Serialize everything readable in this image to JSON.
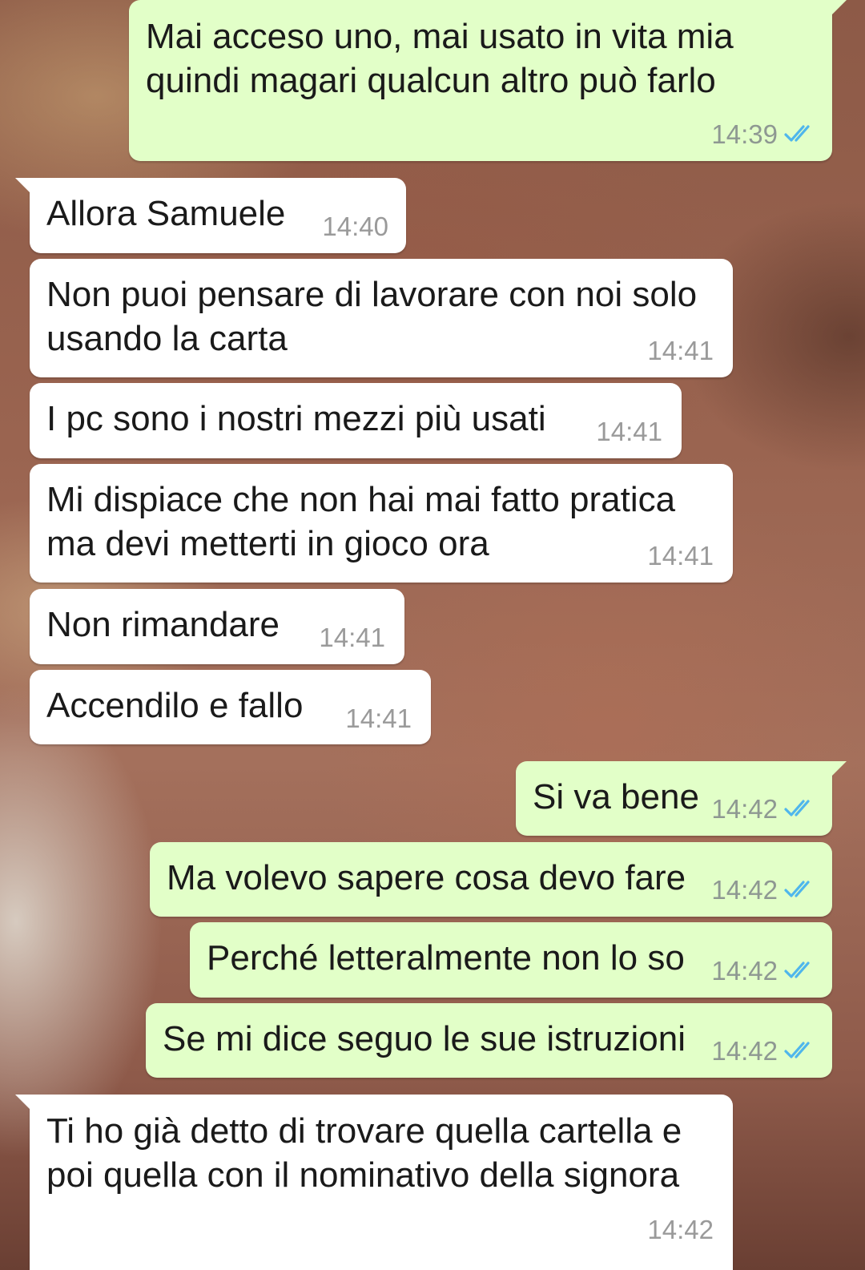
{
  "messages": [
    {
      "direction": "outgoing",
      "text": "Mai acceso uno, mai usato in vita mia\nquindi magari qualcun altro può farlo",
      "time": "14:39",
      "status_icon": "double-check-read-icon"
    },
    {
      "direction": "incoming",
      "text": "Allora Samuele",
      "time": "14:40"
    },
    {
      "direction": "incoming",
      "text": "Non puoi pensare di lavorare con noi solo\nusando la carta",
      "time": "14:41"
    },
    {
      "direction": "incoming",
      "text": "I pc sono i nostri mezzi più usati",
      "time": "14:41"
    },
    {
      "direction": "incoming",
      "text": "Mi dispiace che non hai mai fatto pratica\nma devi metterti in gioco ora",
      "time": "14:41"
    },
    {
      "direction": "incoming",
      "text": "Non rimandare",
      "time": "14:41"
    },
    {
      "direction": "incoming",
      "text": "Accendilo e fallo",
      "time": "14:41"
    },
    {
      "direction": "outgoing",
      "text": "Si va bene",
      "time": "14:42",
      "status_icon": "double-check-read-icon"
    },
    {
      "direction": "outgoing",
      "text": "Ma volevo sapere cosa devo fare",
      "time": "14:42",
      "status_icon": "double-check-read-icon"
    },
    {
      "direction": "outgoing",
      "text": "Perché letteralmente non lo so",
      "time": "14:42",
      "status_icon": "double-check-read-icon"
    },
    {
      "direction": "outgoing",
      "text": "Se mi dice seguo le sue istruzioni",
      "time": "14:42",
      "status_icon": "double-check-read-icon"
    },
    {
      "direction": "incoming",
      "text": "Ti ho già detto di trovare quella cartella e\npoi quella con il nominativo della signora",
      "time": "14:42"
    }
  ],
  "colors": {
    "outgoing_bubble": "#e2ffc8",
    "incoming_bubble": "#ffffff",
    "read_ticks": "#4fb6ec",
    "timestamp": "#8e9892"
  }
}
